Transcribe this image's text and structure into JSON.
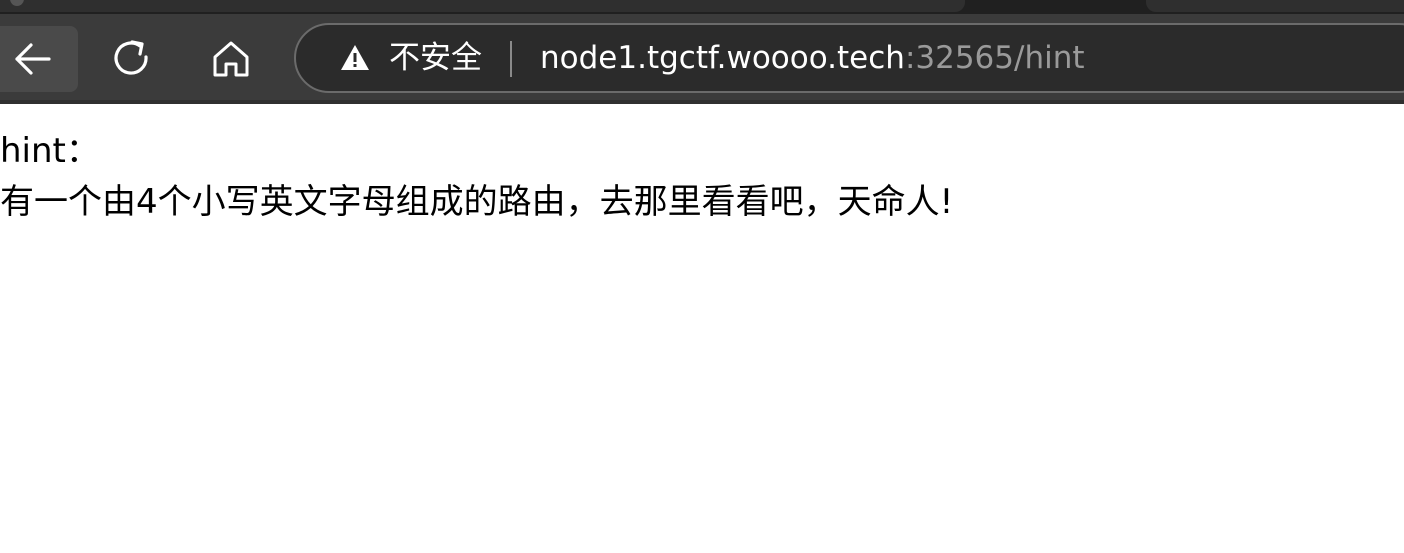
{
  "browser": {
    "colors": {
      "toolbar": "#3b3b3b",
      "address_bar": "#2b2b2b",
      "page_background": "#ffffff"
    },
    "nav": {
      "back_icon": "arrow-left-icon",
      "reload_icon": "reload-icon",
      "home_icon": "home-icon"
    },
    "address_bar": {
      "security_icon": "warning-triangle-icon",
      "security_label": "不安全",
      "url_host": "node1.tgctf.woooo.tech",
      "url_rest": ":32565/hint"
    }
  },
  "page": {
    "heading": "hint：",
    "message": "有一个由4个小写英文字母组成的路由，去那里看看吧，天命人!"
  }
}
